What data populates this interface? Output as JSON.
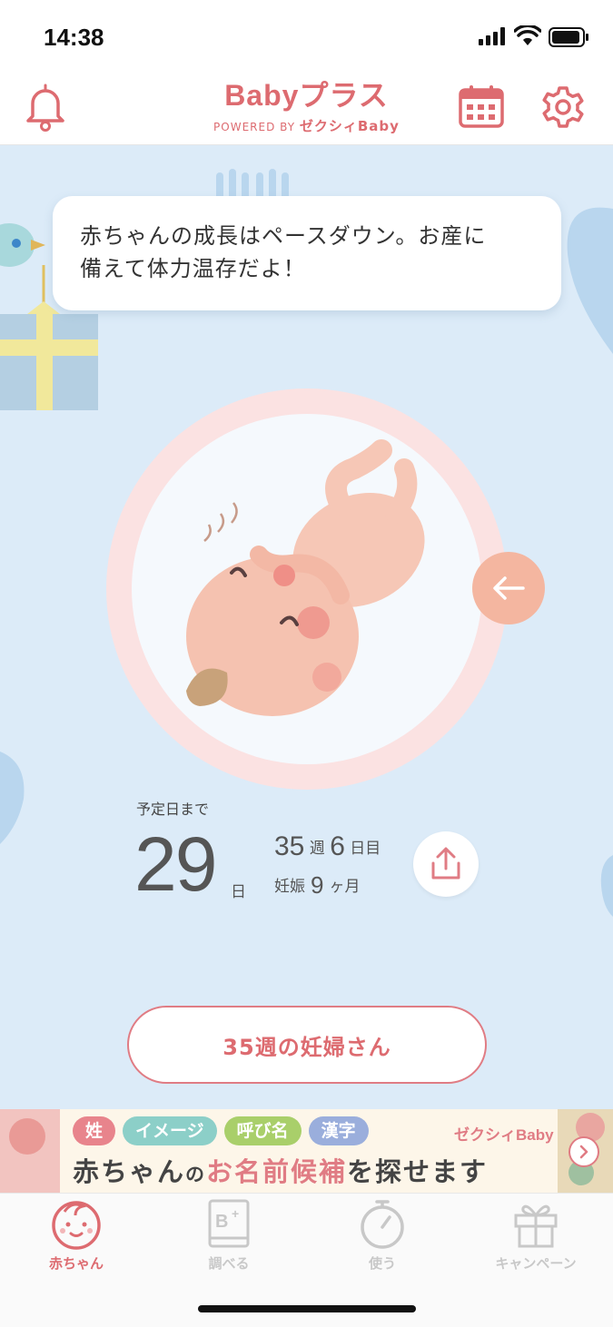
{
  "status_bar": {
    "time": "14:38"
  },
  "header": {
    "logo_main": "Babyプラス",
    "logo_powered": "POWERED BY",
    "logo_brand": "ゼクシィBaby",
    "left_icon": "bell-icon",
    "right_icons": [
      "calendar-icon",
      "gear-icon"
    ]
  },
  "message": {
    "line1": "赤ちゃんの成長はペースダウン。お産に",
    "line2": "備えて体力温存だよ！"
  },
  "countdown": {
    "label": "予定日まで",
    "days": "29",
    "days_unit": "日",
    "week_num": "35",
    "week_unit": "週",
    "day_num": "6",
    "day_unit": "日目",
    "pregnancy_label": "妊娠",
    "month_num": "9",
    "month_unit": "ヶ月"
  },
  "pill_button": {
    "label": "35週の妊婦さん"
  },
  "banner": {
    "tags": [
      {
        "label": "姓",
        "color": "#e8848c"
      },
      {
        "label": "イメージ",
        "color": "#8ccfc8"
      },
      {
        "label": "呼び名",
        "color": "#a9cf6a"
      },
      {
        "label": "漢字",
        "color": "#9aaedc"
      }
    ],
    "brand": "ゼクシィBaby",
    "headline_1": "赤ちゃん",
    "headline_2": "の",
    "headline_3": "お名前候補",
    "headline_4": "を探せます"
  },
  "tabs": [
    {
      "label": "赤ちゃん",
      "icon": "baby-face-icon",
      "active": true
    },
    {
      "label": "調べる",
      "icon": "book-icon",
      "active": false
    },
    {
      "label": "使う",
      "icon": "stopwatch-icon",
      "active": false
    },
    {
      "label": "キャンペーン",
      "icon": "gift-icon",
      "active": false
    }
  ],
  "colors": {
    "accent": "#dd6b70",
    "background": "#dcebf8",
    "arrow_button": "#f4b6a0"
  }
}
